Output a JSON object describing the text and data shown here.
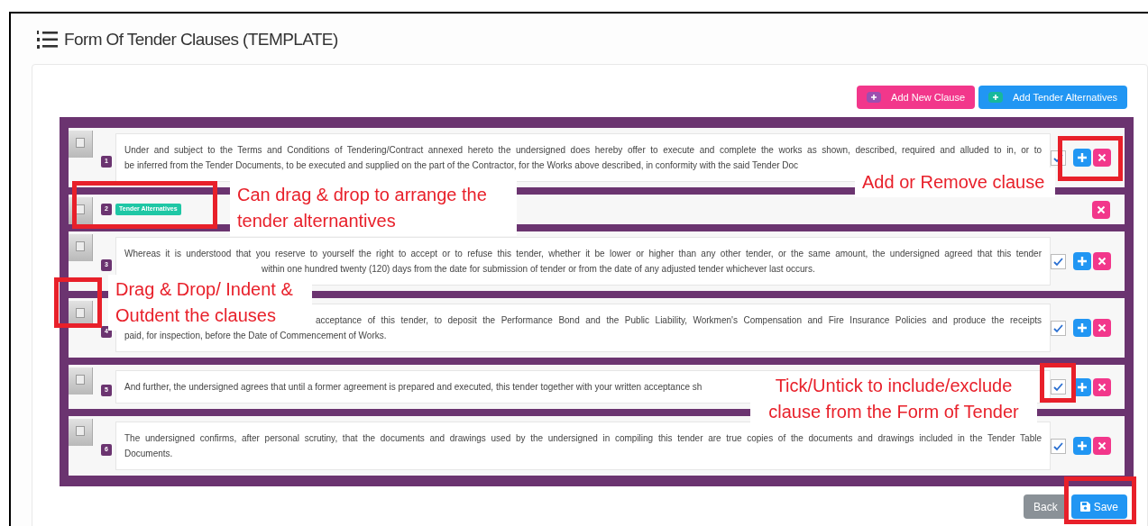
{
  "title": "Form Of Tender Clauses (TEMPLATE)",
  "toolbar": [
    {
      "kind": "pink",
      "label": "Add New Clause"
    },
    {
      "kind": "blue",
      "label": "Add Tender Alternatives"
    }
  ],
  "rows": [
    {
      "kind": "clause",
      "number": "1",
      "checked": true,
      "lines": [
        {
          "kind": "full",
          "text": "Under and subject to the Terms and Conditions of Tendering/Contract annexed hereto the undersigned does hereby offer to execute and complete the works as shown, described, required and alluded to in, or to"
        },
        {
          "kind": "head",
          "text": "be inferred from the Tender Documents, to be executed and supplied on the part of the Contractor, for the Works above described, in conformity with the said Tender Doc"
        }
      ]
    },
    {
      "kind": "group",
      "number": "2",
      "badge": "Tender Alternatives"
    },
    {
      "kind": "clause",
      "number": "3",
      "checked": true,
      "lines": [
        {
          "kind": "full",
          "text": "Whereas it is understood that you reserve to yourself the right to accept or to refuse this tender, whether it be lower or higher than any other tender, or the same amount, the undersigned agreed that this tender"
        },
        {
          "kind": "tail",
          "text": "within one hundred twenty (120) days from the date for submission of tender or from the date of any adjusted tender whichever last occurs."
        }
      ]
    },
    {
      "kind": "clause",
      "number": "4",
      "checked": true,
      "lines": [
        {
          "kind": "tailfull",
          "text": "acceptance of this tender, to deposit the Performance Bond and the Public Liability, Workmen's Compensation and Fire Insurance Policies and produce the receipts"
        },
        {
          "kind": "head",
          "text": "paid, for inspection, before the Date of Commencement of Works."
        }
      ]
    },
    {
      "kind": "clause",
      "number": "5",
      "checked": true,
      "lines": [
        {
          "kind": "head",
          "text": "And further, the undersigned agrees that until a former agreement is prepared and executed, this tender together with your written acceptance sh"
        }
      ]
    },
    {
      "kind": "clause",
      "number": "6",
      "checked": true,
      "lines": [
        {
          "kind": "full",
          "text": "The undersigned confirms, after personal scrutiny, that the documents and drawings used by the undersigned in compiling this tender are true copies of the documents and drawings included in the Tender Table"
        },
        {
          "kind": "head",
          "text": "Documents."
        }
      ]
    }
  ],
  "footer_buttons": [
    {
      "kind": "back",
      "label": "Back"
    },
    {
      "kind": "save",
      "label": "Save"
    }
  ],
  "callouts": [
    "Add or Remove clause",
    "Can drag & drop to arrange the tender alternantives",
    "Drag & Drop/ Indent & Outdent the clauses",
    "Tick/Untick to include/exclude clause from the Form of Tender"
  ]
}
